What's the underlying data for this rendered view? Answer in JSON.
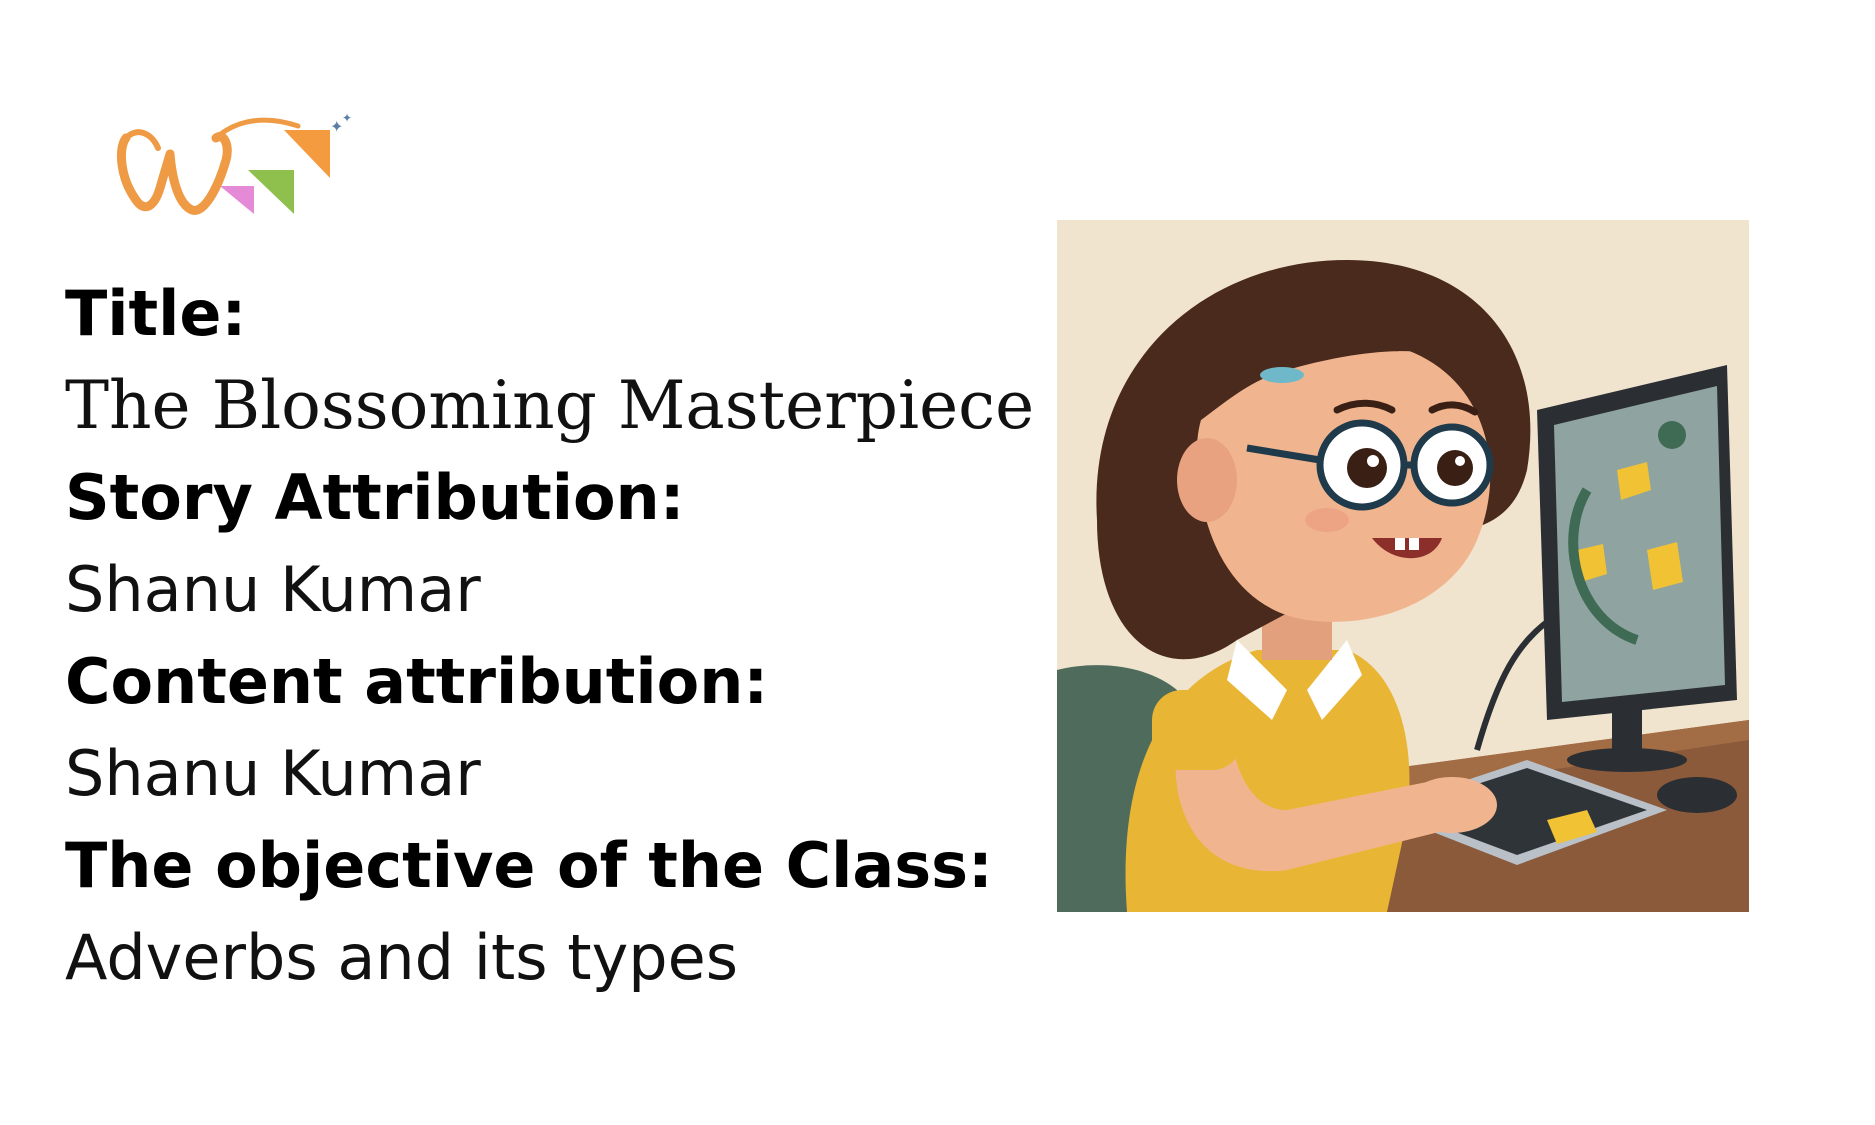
{
  "logo": {
    "letter": "W",
    "icon": "w-logo-icon",
    "colors": {
      "letter": "#ef9a45",
      "triangle_orange": "#f49a3f",
      "triangle_green": "#8fbf4d",
      "triangle_pink": "#e58ad6"
    }
  },
  "content": {
    "title_label": "Title:",
    "title_value": "The Blossoming Masterpiece",
    "story_label": "Story Attribution:",
    "story_value": "Shanu Kumar",
    "content_label": "Content attribution:",
    "content_value": "Shanu Kumar",
    "objective_label": "The objective of the Class:",
    "objective_value": "Adverbs and its types"
  },
  "illustration": {
    "icon": "girl-at-computer-illustration",
    "colors": {
      "background": "#f1e4cf",
      "hair": "#4a2a1c",
      "skin": "#f0b58f",
      "shirt": "#e8b534",
      "desk": "#8a5a3b",
      "monitor": "#2b2f33",
      "screen": "#8fa3a1",
      "puzzle": "#f0c234"
    }
  }
}
